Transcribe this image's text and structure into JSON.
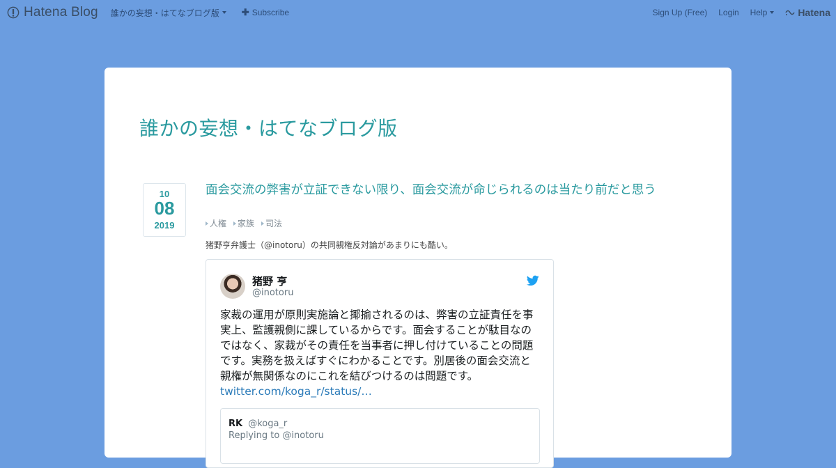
{
  "header": {
    "brand": "Hatena Blog",
    "blog_menu_label": "誰かの妄想・はてなブログ版",
    "subscribe_label": "Subscribe",
    "signup_label": "Sign Up (Free)",
    "login_label": "Login",
    "help_label": "Help",
    "hatena_label": "Hatena"
  },
  "blog": {
    "title": "誰かの妄想・はてなブログ版"
  },
  "entry": {
    "date": {
      "month": "10",
      "day": "08",
      "year": "2019"
    },
    "title": "面会交流の弊害が立証できない限り、面会交流が命じられるのは当たり前だと思う",
    "categories": [
      "人権",
      "家族",
      "司法"
    ],
    "intro": "猪野亨弁護士（@inotoru）の共同親権反対論があまりにも酷い。"
  },
  "tweet": {
    "name": "猪野 亨",
    "handle": "@inotoru",
    "body": "家裁の運用が原則実施論と揶揄されるのは、弊害の立証責任を事実上、監護親側に課しているからです。面会することが駄目なのではなく、家裁がその責任を当事者に押し付けていることの問題です。実務を扱えばすぐにわかることです。別居後の面会交流と親権が無関係なのにこれを結びつけるのは問題です。",
    "link": "twitter.com/koga_r/status/…",
    "quoted": {
      "name": "RK",
      "handle": "@koga_r",
      "reply": "Replying to @inotoru"
    }
  },
  "colors": {
    "background": "#6b9de0",
    "accent": "#2a9a9f",
    "twitter_blue": "#1da1f2",
    "link": "#2b7bb9"
  },
  "icons": [
    "hatena-blog-logo-icon",
    "plus-icon",
    "caret-down-icon",
    "hatena-logo-icon",
    "category-triangle-icon",
    "twitter-bird-icon",
    "avatar"
  ]
}
